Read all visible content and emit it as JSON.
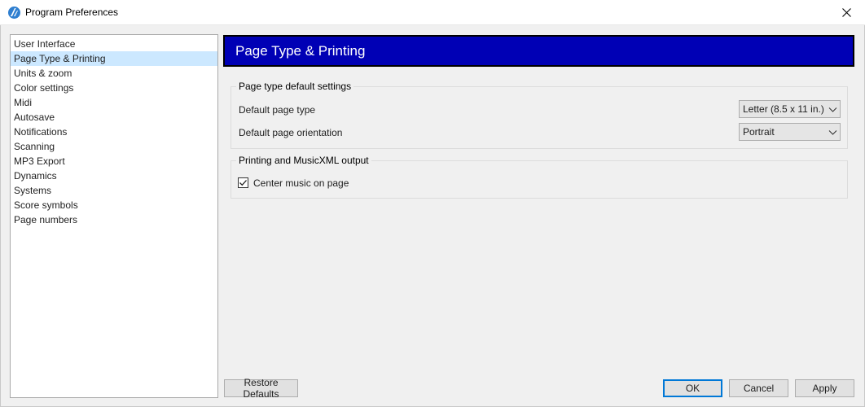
{
  "window": {
    "title": "Program Preferences",
    "icon": "app-logo-icon",
    "close_icon": "close-icon"
  },
  "sidebar": {
    "items": [
      {
        "label": "User Interface",
        "selected": false
      },
      {
        "label": "Page Type & Printing",
        "selected": true
      },
      {
        "label": "Units & zoom",
        "selected": false
      },
      {
        "label": "Color settings",
        "selected": false
      },
      {
        "label": "Midi",
        "selected": false
      },
      {
        "label": "Autosave",
        "selected": false
      },
      {
        "label": "Notifications",
        "selected": false
      },
      {
        "label": "Scanning",
        "selected": false
      },
      {
        "label": "MP3 Export",
        "selected": false
      },
      {
        "label": "Dynamics",
        "selected": false
      },
      {
        "label": "Systems",
        "selected": false
      },
      {
        "label": "Score symbols",
        "selected": false
      },
      {
        "label": "Page numbers",
        "selected": false
      }
    ]
  },
  "header": {
    "title": "Page Type & Printing",
    "background": "#0000b5"
  },
  "page_type_group": {
    "legend": "Page type default settings",
    "page_type_label": "Default page type",
    "page_type_value": "Letter (8.5 x 11 in.)",
    "orientation_label": "Default page orientation",
    "orientation_value": "Portrait"
  },
  "printing_group": {
    "legend": "Printing and MusicXML output",
    "center_music_label": "Center music on page",
    "center_music_checked": true
  },
  "buttons": {
    "restore_defaults": "Restore Defaults",
    "ok": "OK",
    "cancel": "Cancel",
    "apply": "Apply"
  },
  "colors": {
    "selection": "#cce8ff",
    "focus_border": "#0078d7"
  }
}
